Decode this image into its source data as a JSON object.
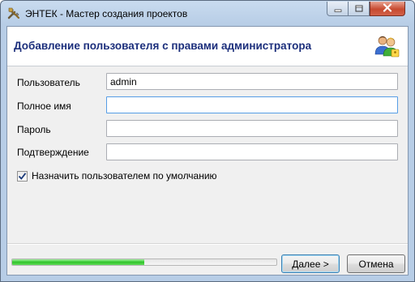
{
  "window": {
    "title": "ЭНТЕК - Мастер создания проектов",
    "app_icon": "tools-icon",
    "controls": [
      "minimize-icon",
      "maximize-icon",
      "close-icon"
    ]
  },
  "header": {
    "title": "Добавление пользователя с правами администратора",
    "icon": "users-icon"
  },
  "form": {
    "user": {
      "label": "Пользователь",
      "value": "admin",
      "placeholder": ""
    },
    "fullname": {
      "label": "Полное имя",
      "value": "",
      "placeholder": ""
    },
    "password": {
      "label": "Пароль",
      "value": "",
      "placeholder": ""
    },
    "confirm": {
      "label": "Подтверждение",
      "value": "",
      "placeholder": ""
    },
    "default_user": {
      "label": "Назначить пользователем по умолчанию",
      "checked": true
    }
  },
  "footer": {
    "progress_fraction": 0.5,
    "next_label": "Далее >",
    "cancel_label": "Отмена"
  },
  "colors": {
    "header_title": "#1c2f7c",
    "progress_fill": "#2fc42a",
    "close_button": "#c74a30"
  }
}
